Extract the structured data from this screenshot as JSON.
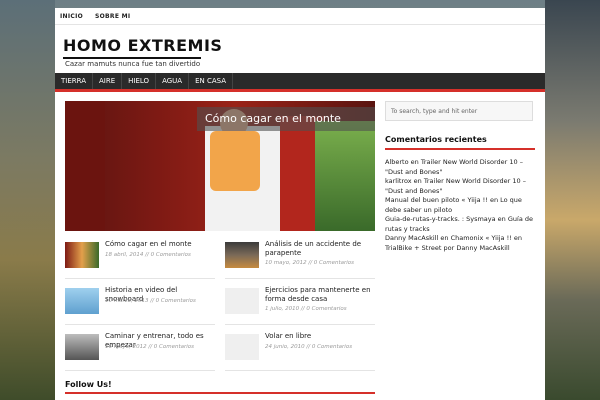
{
  "top_links": [
    "INICIO",
    "SOBRE MI"
  ],
  "site": {
    "title": "HOMO EXTREMIS",
    "tagline": "Cazar mamuts nunca fue tan divertido"
  },
  "nav": [
    "TIERRA",
    "AIRE",
    "HIELO",
    "AGUA",
    "EN CASA"
  ],
  "featured": {
    "title": "Cómo cagar en el monte"
  },
  "posts": [
    {
      "title": "Cómo cagar en el monte",
      "meta": "18 abril, 2014 // 0 Comentarios"
    },
    {
      "title": "Análisis de un accidente de parapente",
      "meta": "10 mayo, 2012 // 0 Comentarios"
    },
    {
      "title": "Historia en video del snowboard",
      "meta": "10 marzo, 2013 // 0 Comentarios"
    },
    {
      "title": "Ejercicios para mantenerte en forma desde casa",
      "meta": "1 julio, 2010 // 0 Comentarios"
    },
    {
      "title": "Caminar y entrenar, todo es empezar",
      "meta": "16 mayo, 2012 // 0 Comentarios"
    },
    {
      "title": "Volar en libre",
      "meta": "24 junio, 2010 // 0 Comentarios"
    }
  ],
  "follow_label": "Follow Us!",
  "search": {
    "placeholder": "To search, type and hit enter"
  },
  "widget": {
    "title": "Comentarios recientes",
    "comments": [
      "Alberto en Trailer New World Disorder 10 – \"Dust and Bones\"",
      "karlitrox en Trailer New World Disorder 10 – \"Dust and Bones\"",
      "Manual del buen piloto « Yiija !! en Lo que debe saber un piloto",
      "Guia-de-rutas-y-tracks. : Sysmaya en Guía de rutas y tracks",
      "Danny MacAskill en Chamonix « Yiija !! en TrialBike + Street por Danny MacAskill"
    ]
  },
  "colors": {
    "accent": "#d5302a",
    "nav_bg": "#2a2a2a"
  },
  "icons": {}
}
